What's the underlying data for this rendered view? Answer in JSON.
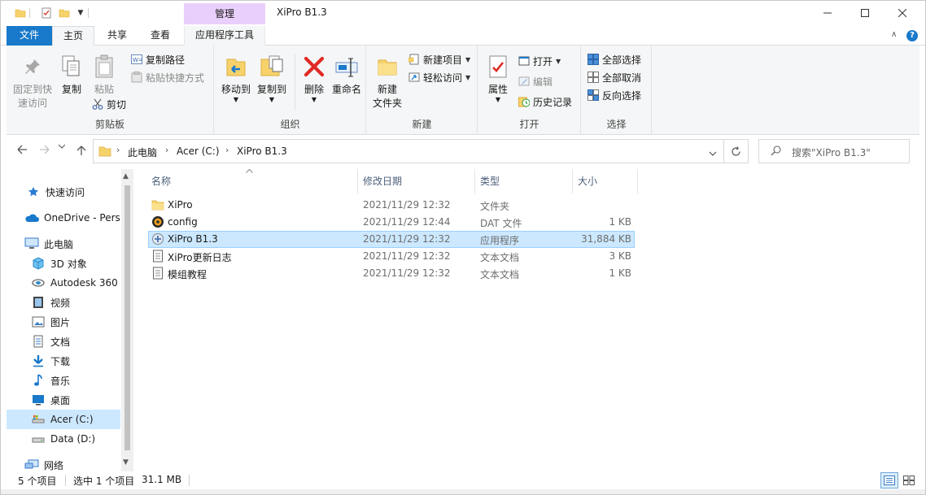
{
  "window": {
    "title": "XiPro B1.3",
    "manage_tab": "管理",
    "controls": {
      "minimize": "—",
      "maximize": "☐",
      "close": "✕"
    }
  },
  "tabs": {
    "file": "文件",
    "home": "主页",
    "share": "共享",
    "view": "查看",
    "app_tools": "应用程序工具"
  },
  "ribbon": {
    "clipboard": {
      "label": "剪贴板",
      "pin": "固定到快\n速访问",
      "pin_l1": "固定到快",
      "pin_l2": "速访问",
      "copy": "复制",
      "paste": "粘贴",
      "copy_path": "复制路径",
      "paste_shortcut": "粘贴快捷方式",
      "cut": "剪切"
    },
    "organize": {
      "label": "组织",
      "move_to": "移动到",
      "copy_to": "复制到",
      "delete": "删除",
      "rename": "重命名"
    },
    "new": {
      "label": "新建",
      "new_folder_l1": "新建",
      "new_folder_l2": "文件夹",
      "new_item": "新建项目",
      "easy_access": "轻松访问"
    },
    "open": {
      "label": "打开",
      "properties": "属性",
      "open": "打开",
      "edit": "编辑",
      "history": "历史记录"
    },
    "select": {
      "label": "选择",
      "select_all": "全部选择",
      "select_none": "全部取消",
      "invert": "反向选择"
    }
  },
  "address": {
    "crumbs": [
      "此电脑",
      "Acer (C:)",
      "XiPro B1.3"
    ],
    "search_placeholder": "搜索\"XiPro B1.3\""
  },
  "nav": {
    "items": [
      {
        "label": "快速访问",
        "icon": "star-icon"
      },
      {
        "label": "OneDrive - Perso",
        "icon": "cloud-icon"
      },
      {
        "label": "此电脑",
        "icon": "computer-icon"
      },
      {
        "label": "3D 对象",
        "icon": "cube-icon"
      },
      {
        "label": "Autodesk 360",
        "icon": "autodesk-icon"
      },
      {
        "label": "视频",
        "icon": "video-icon"
      },
      {
        "label": "图片",
        "icon": "picture-icon"
      },
      {
        "label": "文档",
        "icon": "document-icon"
      },
      {
        "label": "下载",
        "icon": "download-icon"
      },
      {
        "label": "音乐",
        "icon": "music-icon"
      },
      {
        "label": "桌面",
        "icon": "desktop-icon"
      },
      {
        "label": "Acer (C:)",
        "icon": "drive-icon"
      },
      {
        "label": "Data (D:)",
        "icon": "drive-icon"
      },
      {
        "label": "网络",
        "icon": "network-icon"
      }
    ]
  },
  "columns": {
    "name": "名称",
    "modified": "修改日期",
    "type": "类型",
    "size": "大小"
  },
  "files": [
    {
      "name": "XiPro",
      "modified": "2021/11/29 12:32",
      "type": "文件夹",
      "size": "",
      "icon": "folder-icon"
    },
    {
      "name": "config",
      "modified": "2021/11/29 12:44",
      "type": "DAT 文件",
      "size": "1 KB",
      "icon": "dat-file-icon"
    },
    {
      "name": "XiPro B1.3",
      "modified": "2021/11/29 12:32",
      "type": "应用程序",
      "size": "31,884 KB",
      "icon": "app-icon"
    },
    {
      "name": "XiPro更新日志",
      "modified": "2021/11/29 12:32",
      "type": "文本文档",
      "size": "3 KB",
      "icon": "text-file-icon"
    },
    {
      "name": "模组教程",
      "modified": "2021/11/29 12:32",
      "type": "文本文档",
      "size": "1 KB",
      "icon": "text-file-icon"
    }
  ],
  "status": {
    "count": "5 个项目",
    "selected": "选中 1 个项目",
    "size": "31.1 MB"
  },
  "colors": {
    "accent": "#1979ca",
    "selection": "#cce8ff",
    "manage": "#e9cffb"
  }
}
